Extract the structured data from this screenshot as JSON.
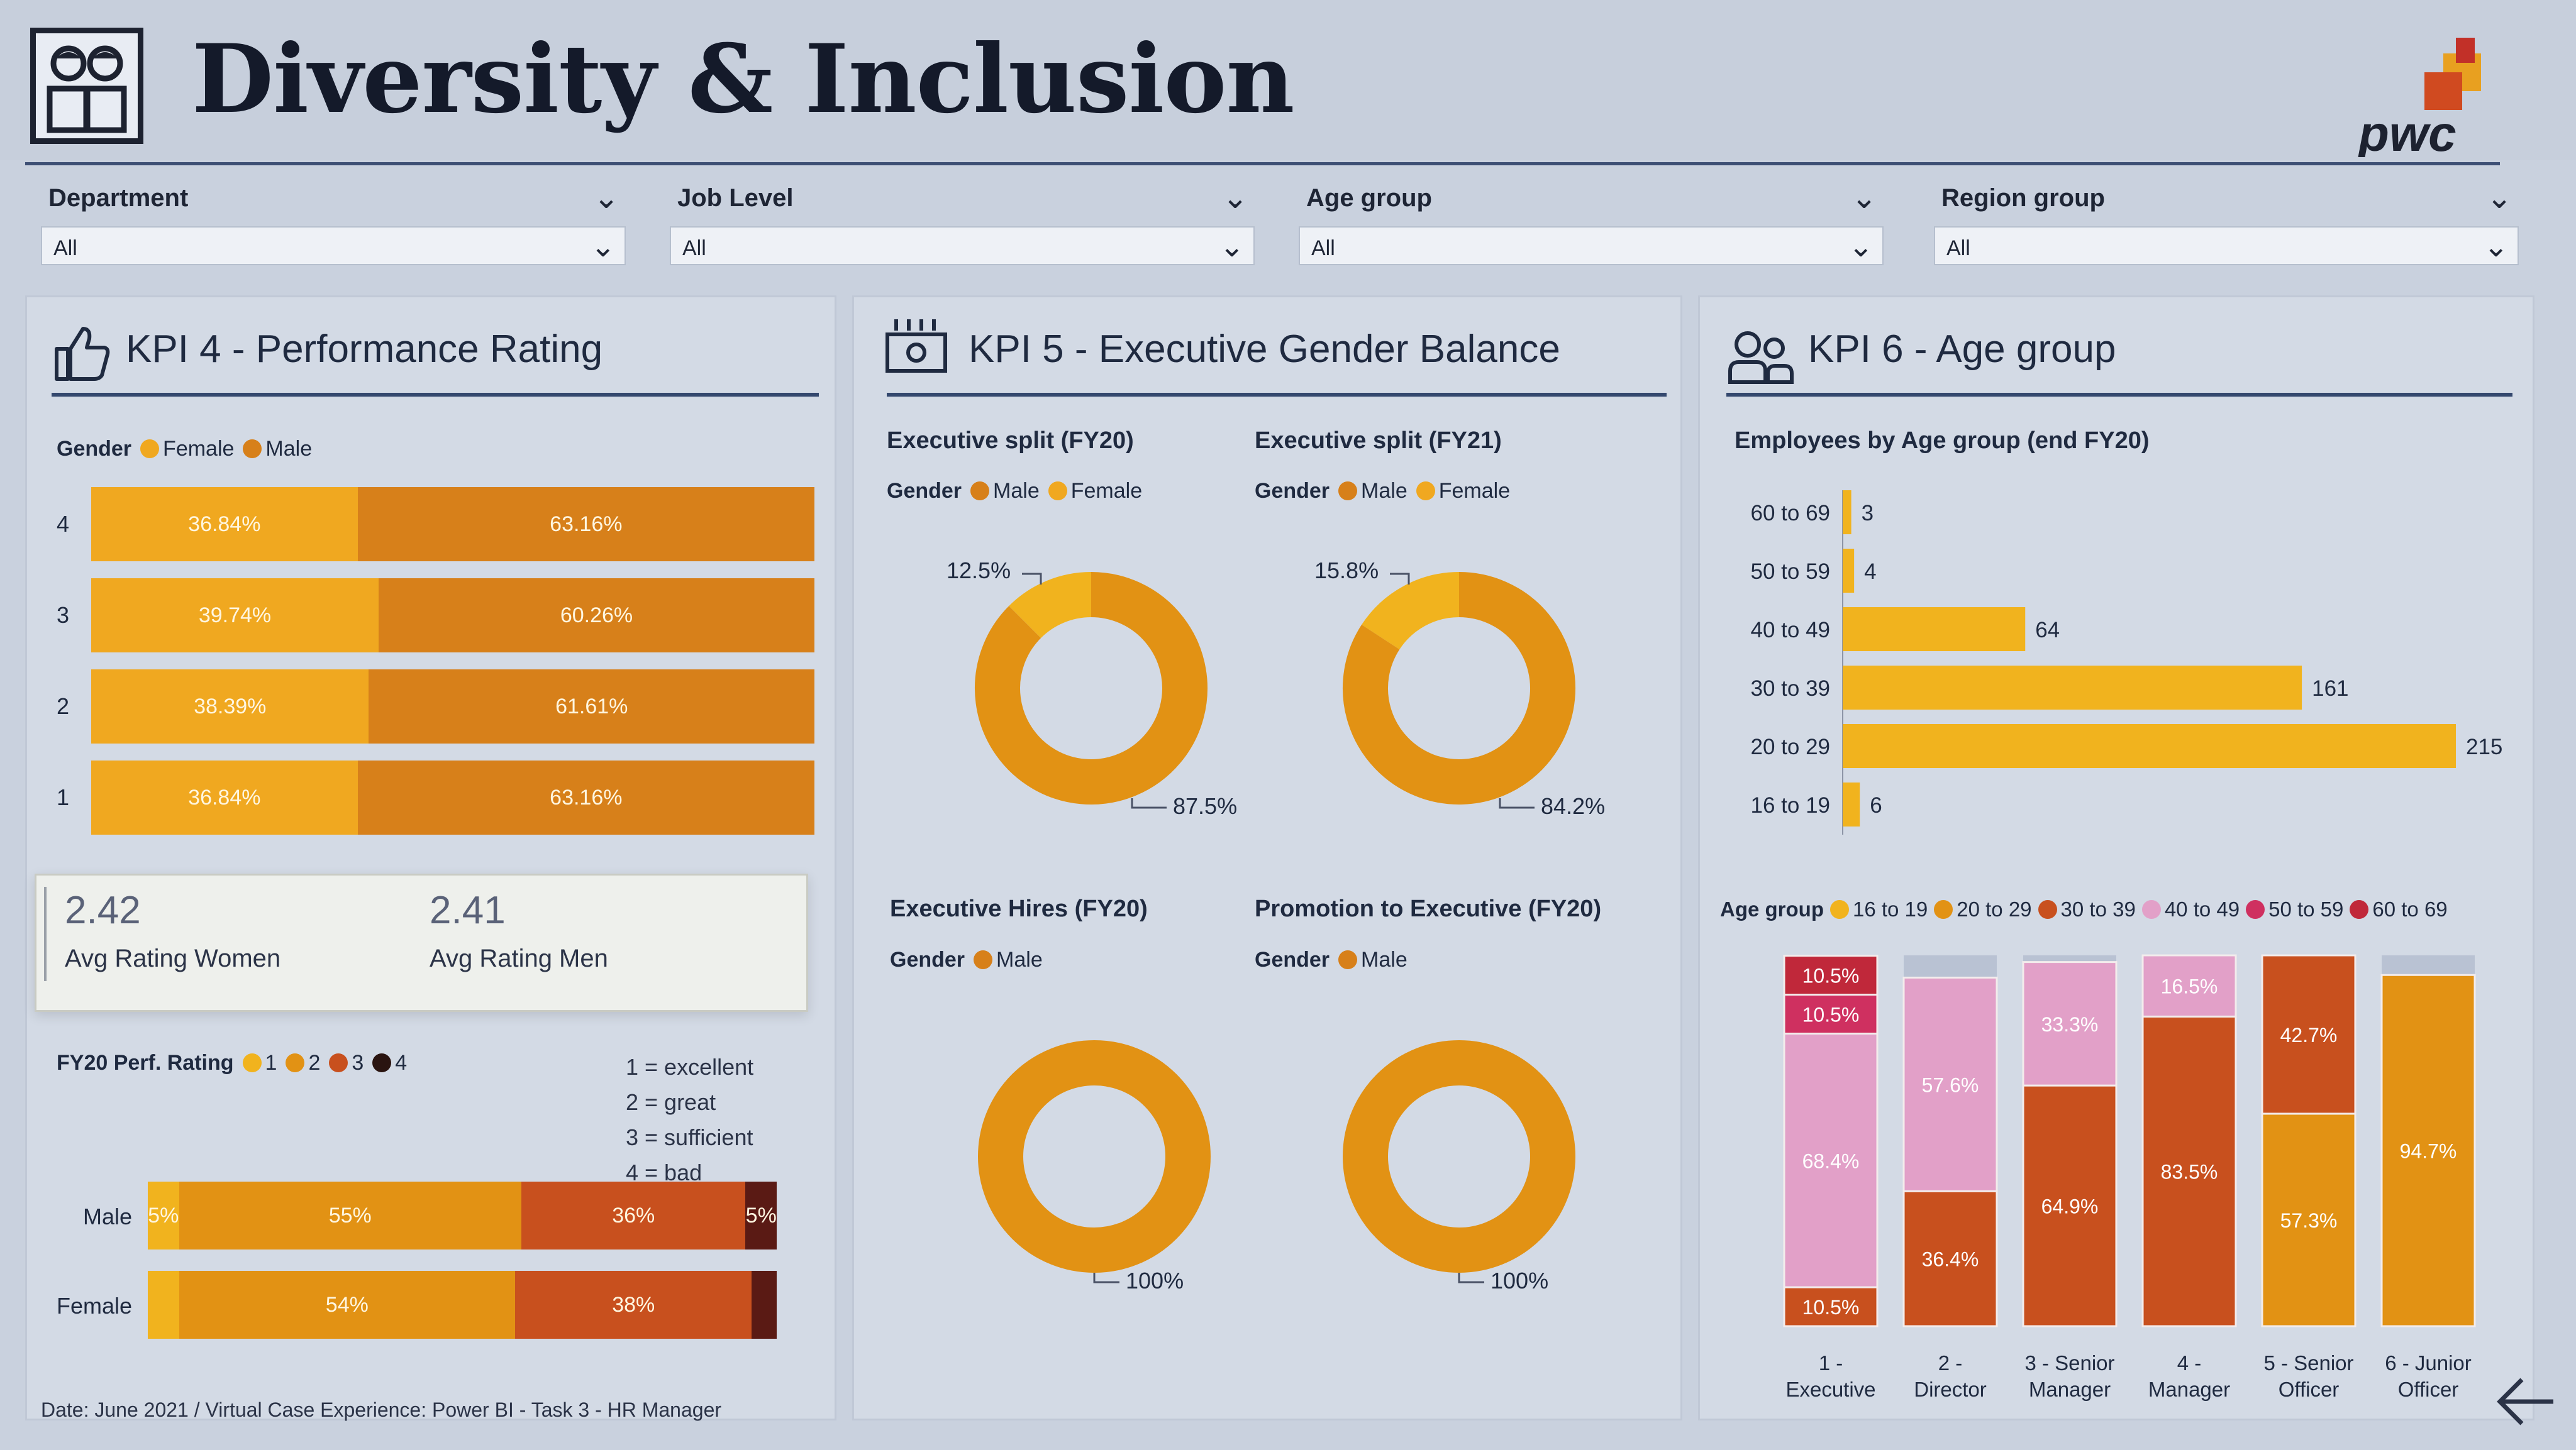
{
  "title": "Diversity & Inclusion",
  "brand": "pwc",
  "colors": {
    "c1": "#f1b31e",
    "c2": "#e29214",
    "c3": "#c8501e",
    "c4": "#5a1a14",
    "female": "#f0a820",
    "male": "#d7801a",
    "pink": "#e2a0c8",
    "magenta": "#cf3060",
    "darkred": "#c0283a"
  },
  "filters": [
    {
      "label": "Department",
      "value": "All"
    },
    {
      "label": "Job Level",
      "value": "All"
    },
    {
      "label": "Age group",
      "value": "All"
    },
    {
      "label": "Region group",
      "value": "All"
    }
  ],
  "kpi4": {
    "title": "KPI 4 - Performance Rating",
    "legend_title": "Gender",
    "legend_female": "Female",
    "legend_male": "Male",
    "women_value": "2.42",
    "women_label": "Avg Rating Women",
    "men_value": "2.41",
    "men_label": "Avg Rating Men",
    "perf_legend_title": "FY20 Perf. Rating",
    "perf_legend": [
      "1",
      "2",
      "3",
      "4"
    ],
    "key": [
      "1 = excellent",
      "2 = great",
      "3 = sufficient",
      "4 = bad"
    ]
  },
  "kpi5": {
    "title": "KPI 5 - Executive Gender Balance",
    "fy20_title": "Executive split (FY20)",
    "fy21_title": "Executive split (FY21)",
    "hires_title": "Executive Hires (FY20)",
    "promo_title": "Promotion to Executive (FY20)",
    "gender": "Gender",
    "male": "Male",
    "female": "Female"
  },
  "kpi6": {
    "title": "KPI 6 - Age group",
    "sub_title": "Employees by Age group (end FY20)",
    "legend_title": "Age group",
    "legend": [
      "16 to 19",
      "20 to 29",
      "30 to 39",
      "40 to 49",
      "50 to 59",
      "60 to 69"
    ]
  },
  "footer": "Date: June 2021 / Virtual Case Experience: Power BI - Task 3 - HR Manager",
  "chart_data": [
    {
      "type": "bar",
      "orientation": "horizontal",
      "stacked": "100%",
      "categories": [
        "4",
        "3",
        "2",
        "1"
      ],
      "series": [
        {
          "name": "Female",
          "values": [
            36.84,
            39.74,
            38.39,
            36.84
          ]
        },
        {
          "name": "Male",
          "values": [
            63.16,
            60.26,
            61.61,
            63.16
          ]
        }
      ],
      "labels": [
        [
          "36.84%",
          "63.16%"
        ],
        [
          "39.74%",
          "60.26%"
        ],
        [
          "38.39%",
          "61.61%"
        ],
        [
          "36.84%",
          "63.16%"
        ]
      ]
    },
    {
      "type": "bar",
      "orientation": "horizontal",
      "stacked": "100%",
      "categories": [
        "Male",
        "Female"
      ],
      "series": [
        {
          "name": "1",
          "values": [
            5,
            5
          ]
        },
        {
          "name": "2",
          "values": [
            55,
            54
          ]
        },
        {
          "name": "3",
          "values": [
            36,
            38
          ]
        },
        {
          "name": "4",
          "values": [
            5,
            4
          ]
        }
      ],
      "labels": [
        [
          "5%",
          "55%",
          "36%",
          "5%"
        ],
        [
          "",
          "54%",
          "38%",
          ""
        ]
      ]
    },
    {
      "type": "pie",
      "title": "Executive split (FY20)",
      "slices": [
        {
          "name": "Female",
          "value": 12.5
        },
        {
          "name": "Male",
          "value": 87.5
        }
      ],
      "labels": [
        "12.5%",
        "87.5%"
      ]
    },
    {
      "type": "pie",
      "title": "Executive split (FY21)",
      "slices": [
        {
          "name": "Female",
          "value": 15.8
        },
        {
          "name": "Male",
          "value": 84.2
        }
      ],
      "labels": [
        "15.8%",
        "84.2%"
      ]
    },
    {
      "type": "pie",
      "title": "Executive Hires (FY20)",
      "slices": [
        {
          "name": "Male",
          "value": 100
        }
      ],
      "labels": [
        "100%"
      ]
    },
    {
      "type": "pie",
      "title": "Promotion to Executive (FY20)",
      "slices": [
        {
          "name": "Male",
          "value": 100
        }
      ],
      "labels": [
        "100%"
      ]
    },
    {
      "type": "bar",
      "orientation": "horizontal",
      "title": "Employees by Age group (end FY20)",
      "categories": [
        "60 to 69",
        "50 to 59",
        "40 to 49",
        "30 to 39",
        "20 to 29",
        "16 to 19"
      ],
      "values": [
        3,
        4,
        64,
        161,
        215,
        6
      ]
    },
    {
      "type": "bar",
      "stacked": "100%",
      "categories": [
        "1 - Executive",
        "2 - Director",
        "3 - Senior Manager",
        "4 - Manager",
        "5 - Senior Officer",
        "6 - Junior Officer"
      ],
      "series": [
        {
          "name": "16 to 19",
          "values": [
            0,
            0,
            0,
            0,
            0,
            0
          ]
        },
        {
          "name": "20 to 29",
          "values": [
            0,
            0,
            0,
            0,
            57.3,
            94.7
          ]
        },
        {
          "name": "30 to 39",
          "values": [
            10.5,
            36.4,
            64.9,
            83.5,
            42.7,
            0
          ]
        },
        {
          "name": "40 to 49",
          "values": [
            68.4,
            57.6,
            33.3,
            16.5,
            0,
            0
          ]
        },
        {
          "name": "50 to 59",
          "values": [
            10.5,
            0,
            0,
            0,
            0,
            0
          ]
        },
        {
          "name": "60 to 69",
          "values": [
            10.5,
            0,
            0,
            0,
            0,
            0
          ]
        }
      ]
    }
  ]
}
